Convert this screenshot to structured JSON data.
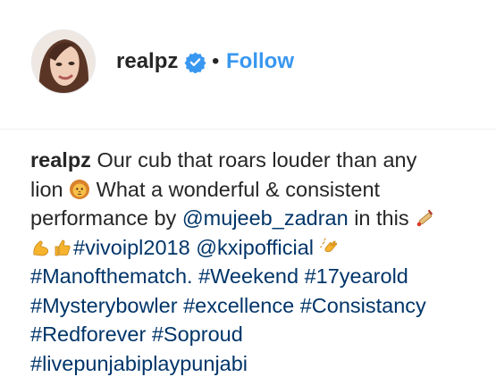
{
  "post": {
    "username": "realpz",
    "verified": true,
    "separator": "•",
    "follow_label": "Follow"
  },
  "caption": {
    "author": "realpz",
    "lines": [
      {
        "segments": [
          {
            "t": "user",
            "text": "realpz"
          },
          {
            "t": "text",
            "text": " Our cub that roars louder than any"
          }
        ]
      },
      {
        "segments": [
          {
            "t": "text",
            "text": "lion "
          },
          {
            "t": "emoji",
            "icon": "lion-face-icon"
          },
          {
            "t": "text",
            "text": " What a wonderful & consistent"
          }
        ]
      },
      {
        "segments": [
          {
            "t": "text",
            "text": "performance by "
          },
          {
            "t": "link",
            "text": "@mujeeb_zadran"
          },
          {
            "t": "text",
            "text": " in this "
          },
          {
            "t": "emoji",
            "icon": "cricket-bat-icon"
          }
        ]
      },
      {
        "segments": [
          {
            "t": "emoji",
            "icon": "flexed-biceps-icon"
          },
          {
            "t": "emoji",
            "icon": "thumbs-up-icon"
          },
          {
            "t": "link",
            "text": "#vivoipl2018"
          },
          {
            "t": "text",
            "text": " "
          },
          {
            "t": "link",
            "text": "@kxipofficial"
          },
          {
            "t": "text",
            "text": " "
          },
          {
            "t": "emoji",
            "icon": "clapping-hands-icon"
          }
        ]
      },
      {
        "segments": [
          {
            "t": "link",
            "text": "#Manofthematch."
          },
          {
            "t": "text",
            "text": " "
          },
          {
            "t": "link",
            "text": "#Weekend"
          },
          {
            "t": "text",
            "text": " "
          },
          {
            "t": "link",
            "text": "#17yearold"
          }
        ]
      },
      {
        "segments": [
          {
            "t": "link",
            "text": "#Mysterybowler"
          },
          {
            "t": "text",
            "text": " "
          },
          {
            "t": "link",
            "text": "#excellence"
          },
          {
            "t": "text",
            "text": " "
          },
          {
            "t": "link",
            "text": "#Consistancy"
          }
        ]
      },
      {
        "segments": [
          {
            "t": "link",
            "text": "#Redforever"
          },
          {
            "t": "text",
            "text": " "
          },
          {
            "t": "link",
            "text": "#Soproud"
          }
        ]
      },
      {
        "segments": [
          {
            "t": "link",
            "text": "#livepunjabiplaypunjabi"
          }
        ]
      }
    ]
  },
  "colors": {
    "link": "#003569",
    "follow": "#3897f0",
    "verified_badge": "#3897f0",
    "text": "#262626"
  },
  "icons": [
    "verified-badge-icon",
    "avatar",
    "lion-face-icon",
    "cricket-bat-icon",
    "flexed-biceps-icon",
    "thumbs-up-icon",
    "clapping-hands-icon"
  ]
}
